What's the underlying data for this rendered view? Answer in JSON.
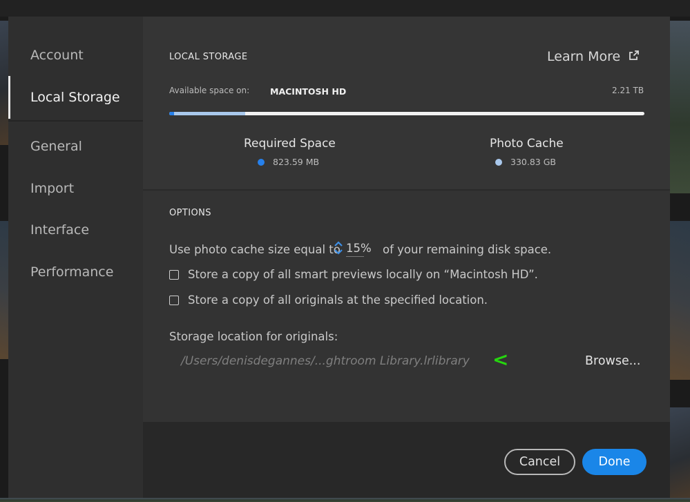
{
  "sidebar": {
    "items": [
      {
        "label": "Account"
      },
      {
        "label": "Local Storage"
      },
      {
        "label": "General"
      },
      {
        "label": "Import"
      },
      {
        "label": "Interface"
      },
      {
        "label": "Performance"
      }
    ],
    "active": "Local Storage"
  },
  "local_storage": {
    "heading": "LOCAL STORAGE",
    "learn_more": "Learn More",
    "available_label": "Available space on:",
    "drive_name": "MACINTOSH HD",
    "total": "2.21 TB",
    "usage_fraction_photo_cache": 0.16,
    "usage_fraction_required": 0.01,
    "required": {
      "title": "Required Space",
      "value": "823.59 MB",
      "color": "#2680eb"
    },
    "cache": {
      "title": "Photo Cache",
      "value": "330.83 GB",
      "color": "#a9c8ec"
    }
  },
  "options": {
    "heading": "OPTIONS",
    "cache_prefix": "Use photo cache size equal to",
    "cache_percent": "15%",
    "cache_suffix": "of your remaining disk space.",
    "smart_previews_label": "Store a copy of all smart previews locally on “Macintosh HD”.",
    "smart_previews_checked": false,
    "originals_label": "Store a copy of all originals at the specified location.",
    "originals_checked": false,
    "storage_location_label": "Storage location for originals:",
    "storage_path": "/Users/denisdegannes/...ghtroom Library.lrlibrary",
    "annotation_marker": "<",
    "browse": "Browse..."
  },
  "footer": {
    "cancel": "Cancel",
    "done": "Done"
  },
  "colors": {
    "accent": "#1a86e8",
    "annotation": "#26d60f"
  }
}
